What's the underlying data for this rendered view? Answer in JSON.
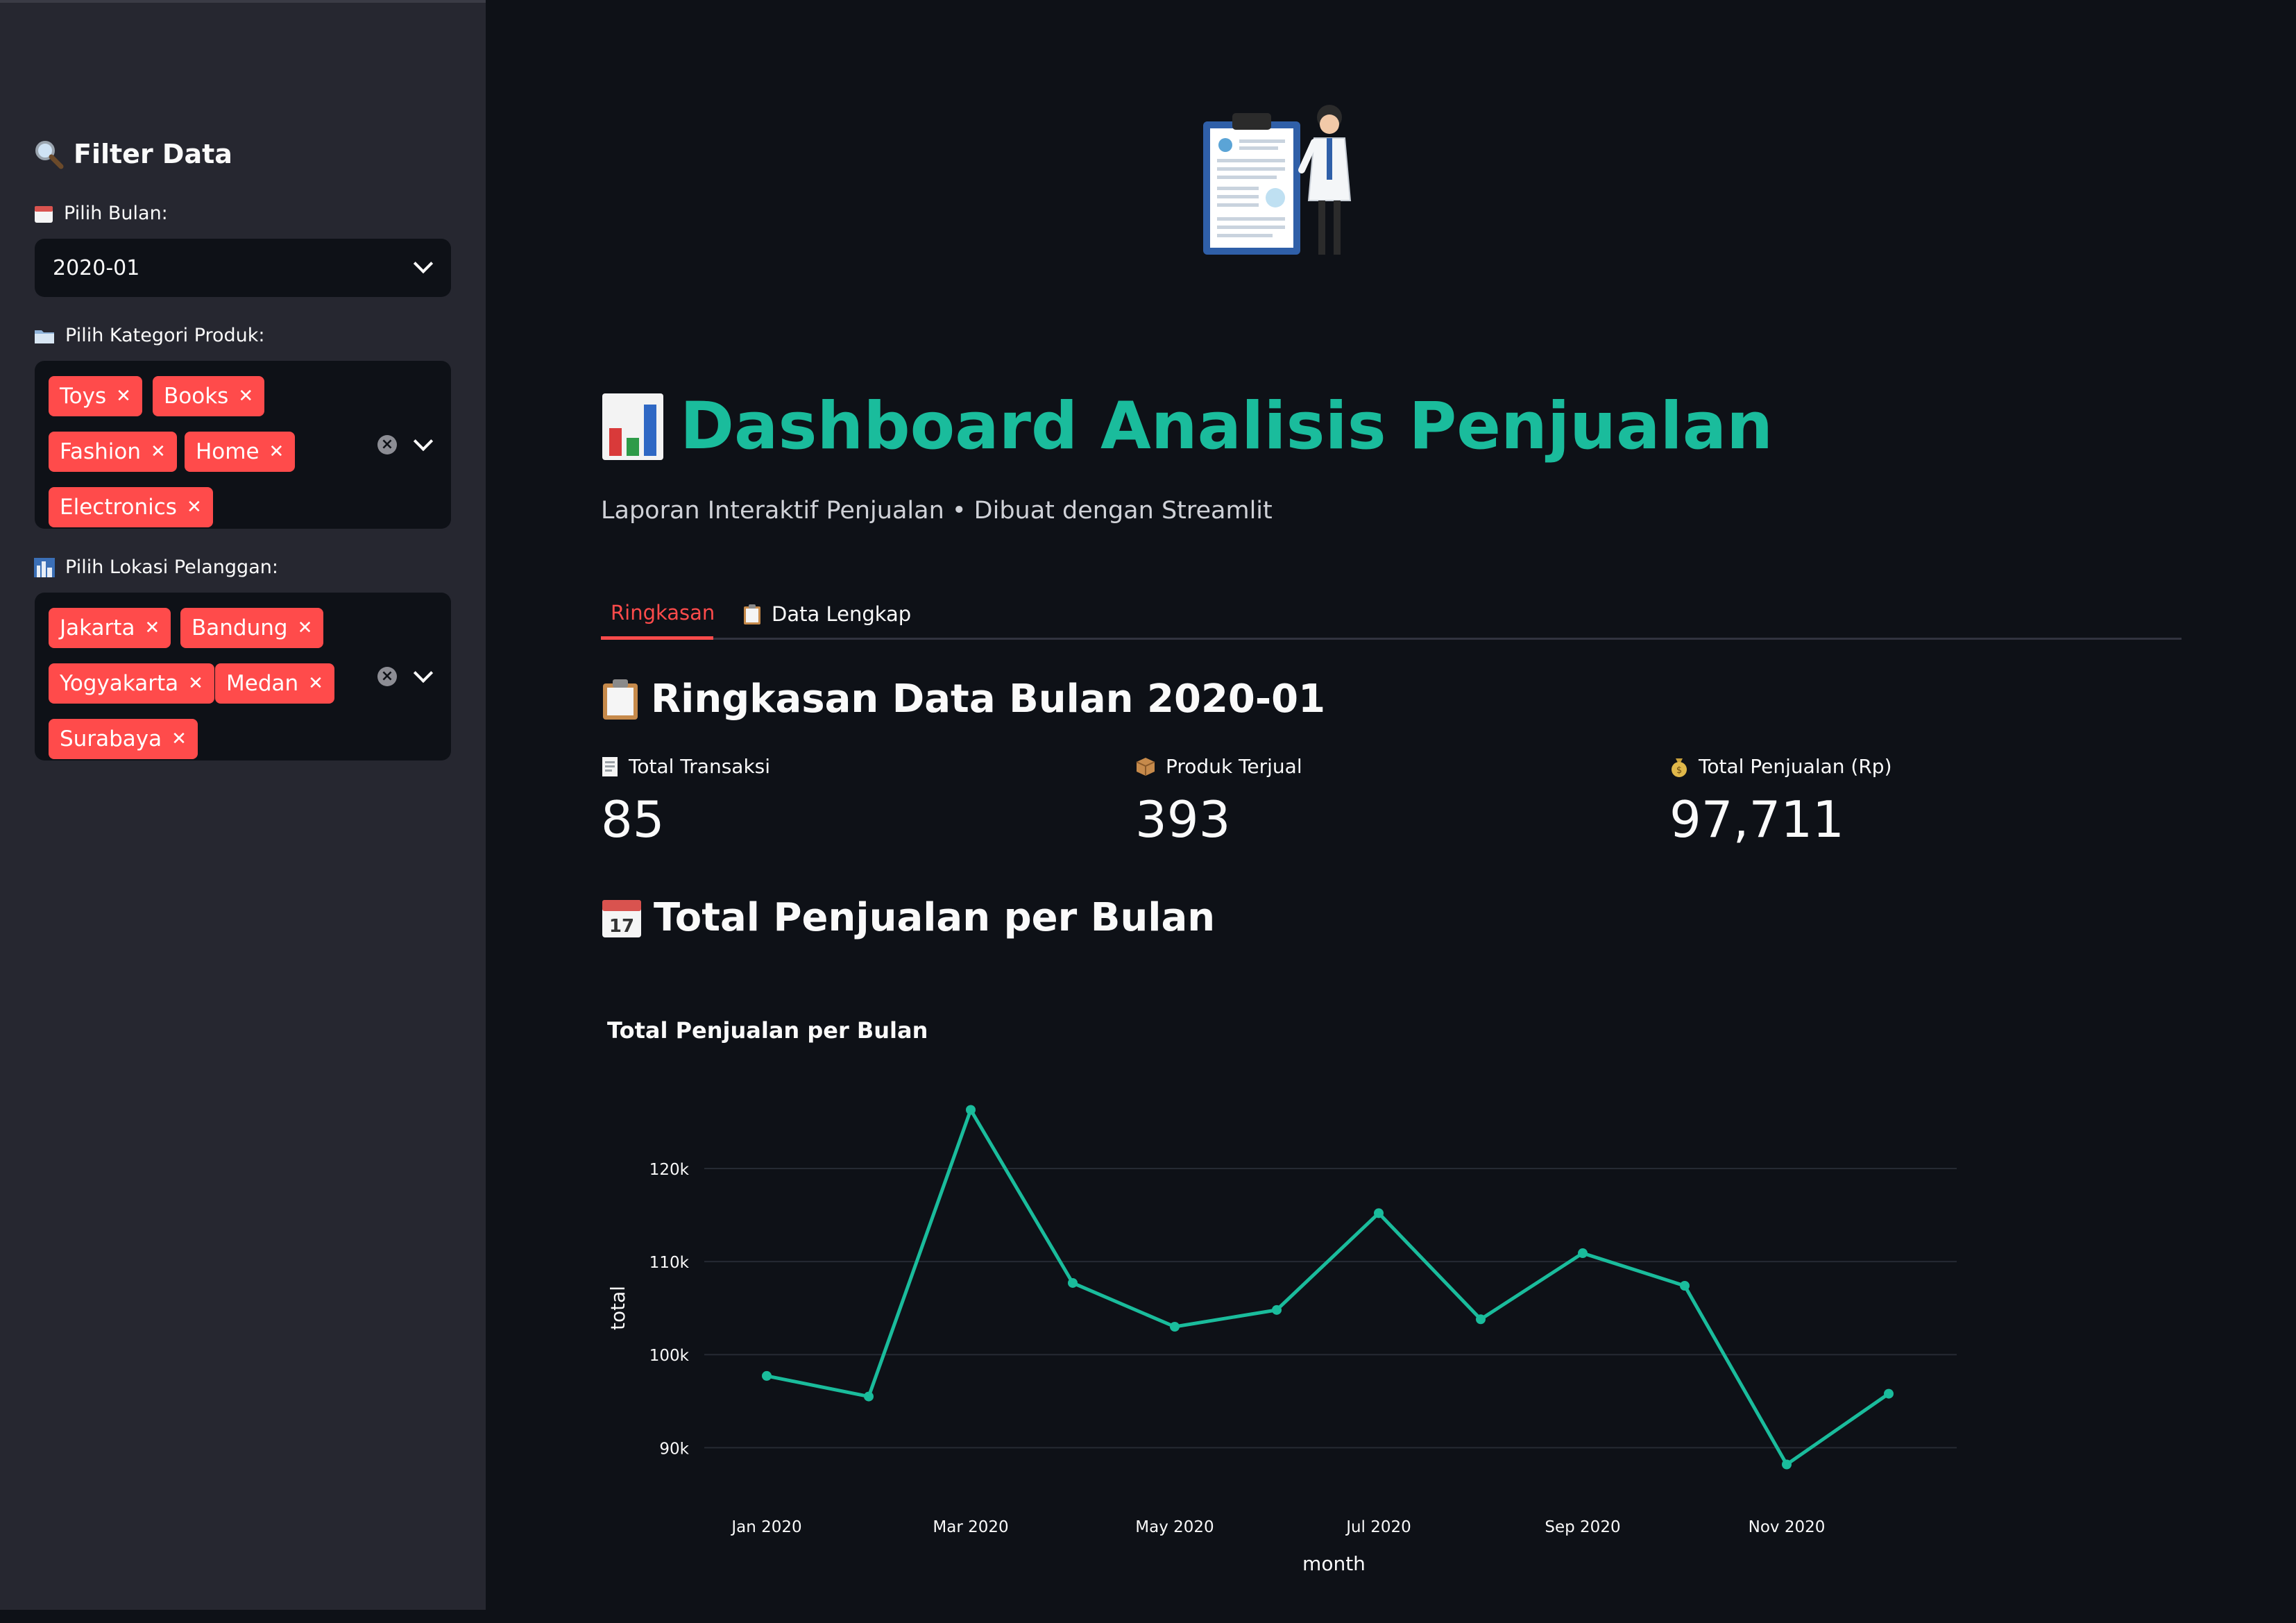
{
  "sidebar": {
    "heading": "Filter Data",
    "month_label": "Pilih Bulan:",
    "month_value": "2020-01",
    "category_label": "Pilih Kategori Produk:",
    "categories": [
      "Toys",
      "Books",
      "Fashion",
      "Home",
      "Electronics"
    ],
    "location_label": "Pilih Lokasi Pelanggan:",
    "locations": [
      "Jakarta",
      "Bandung",
      "Yogyakarta",
      "Medan",
      "Surabaya"
    ]
  },
  "header": {
    "title": "Dashboard Analisis Penjualan",
    "subtitle": "Laporan Interaktif Penjualan • Dibuat dengan Streamlit",
    "title_color": "#1abc9c"
  },
  "tabs": [
    {
      "label": "Ringkasan",
      "active": true
    },
    {
      "label": "Data Lengkap",
      "active": false
    }
  ],
  "summary": {
    "heading": "Ringkasan Data Bulan 2020-01",
    "metrics": [
      {
        "label": "Total Transaksi",
        "value": "85"
      },
      {
        "label": "Produk Terjual",
        "value": "393"
      },
      {
        "label": "Total Penjualan (Rp)",
        "value": "97,711"
      }
    ]
  },
  "sales_section": {
    "heading": "Total Penjualan per Bulan"
  },
  "chart_data": {
    "type": "line",
    "title": "Total Penjualan per Bulan",
    "xlabel": "month",
    "ylabel": "total",
    "x": [
      "2020-01",
      "2020-02",
      "2020-03",
      "2020-04",
      "2020-05",
      "2020-06",
      "2020-07",
      "2020-08",
      "2020-09",
      "2020-10",
      "2020-11",
      "2020-12"
    ],
    "x_tick_labels": [
      "Jan 2020",
      "Mar 2020",
      "May 2020",
      "Jul 2020",
      "Sep 2020",
      "Nov 2020"
    ],
    "y_tick_labels": [
      "90k",
      "100k",
      "110k",
      "120k"
    ],
    "y_ticks": [
      90000,
      100000,
      110000,
      120000
    ],
    "series": [
      {
        "values": [
          97711,
          95500,
          126300,
          107700,
          103000,
          104800,
          115200,
          103800,
          110900,
          107400,
          88200,
          95800
        ]
      }
    ],
    "ylim": [
      86000,
      128500
    ],
    "grid": true,
    "line_color": "#1abc9c"
  }
}
